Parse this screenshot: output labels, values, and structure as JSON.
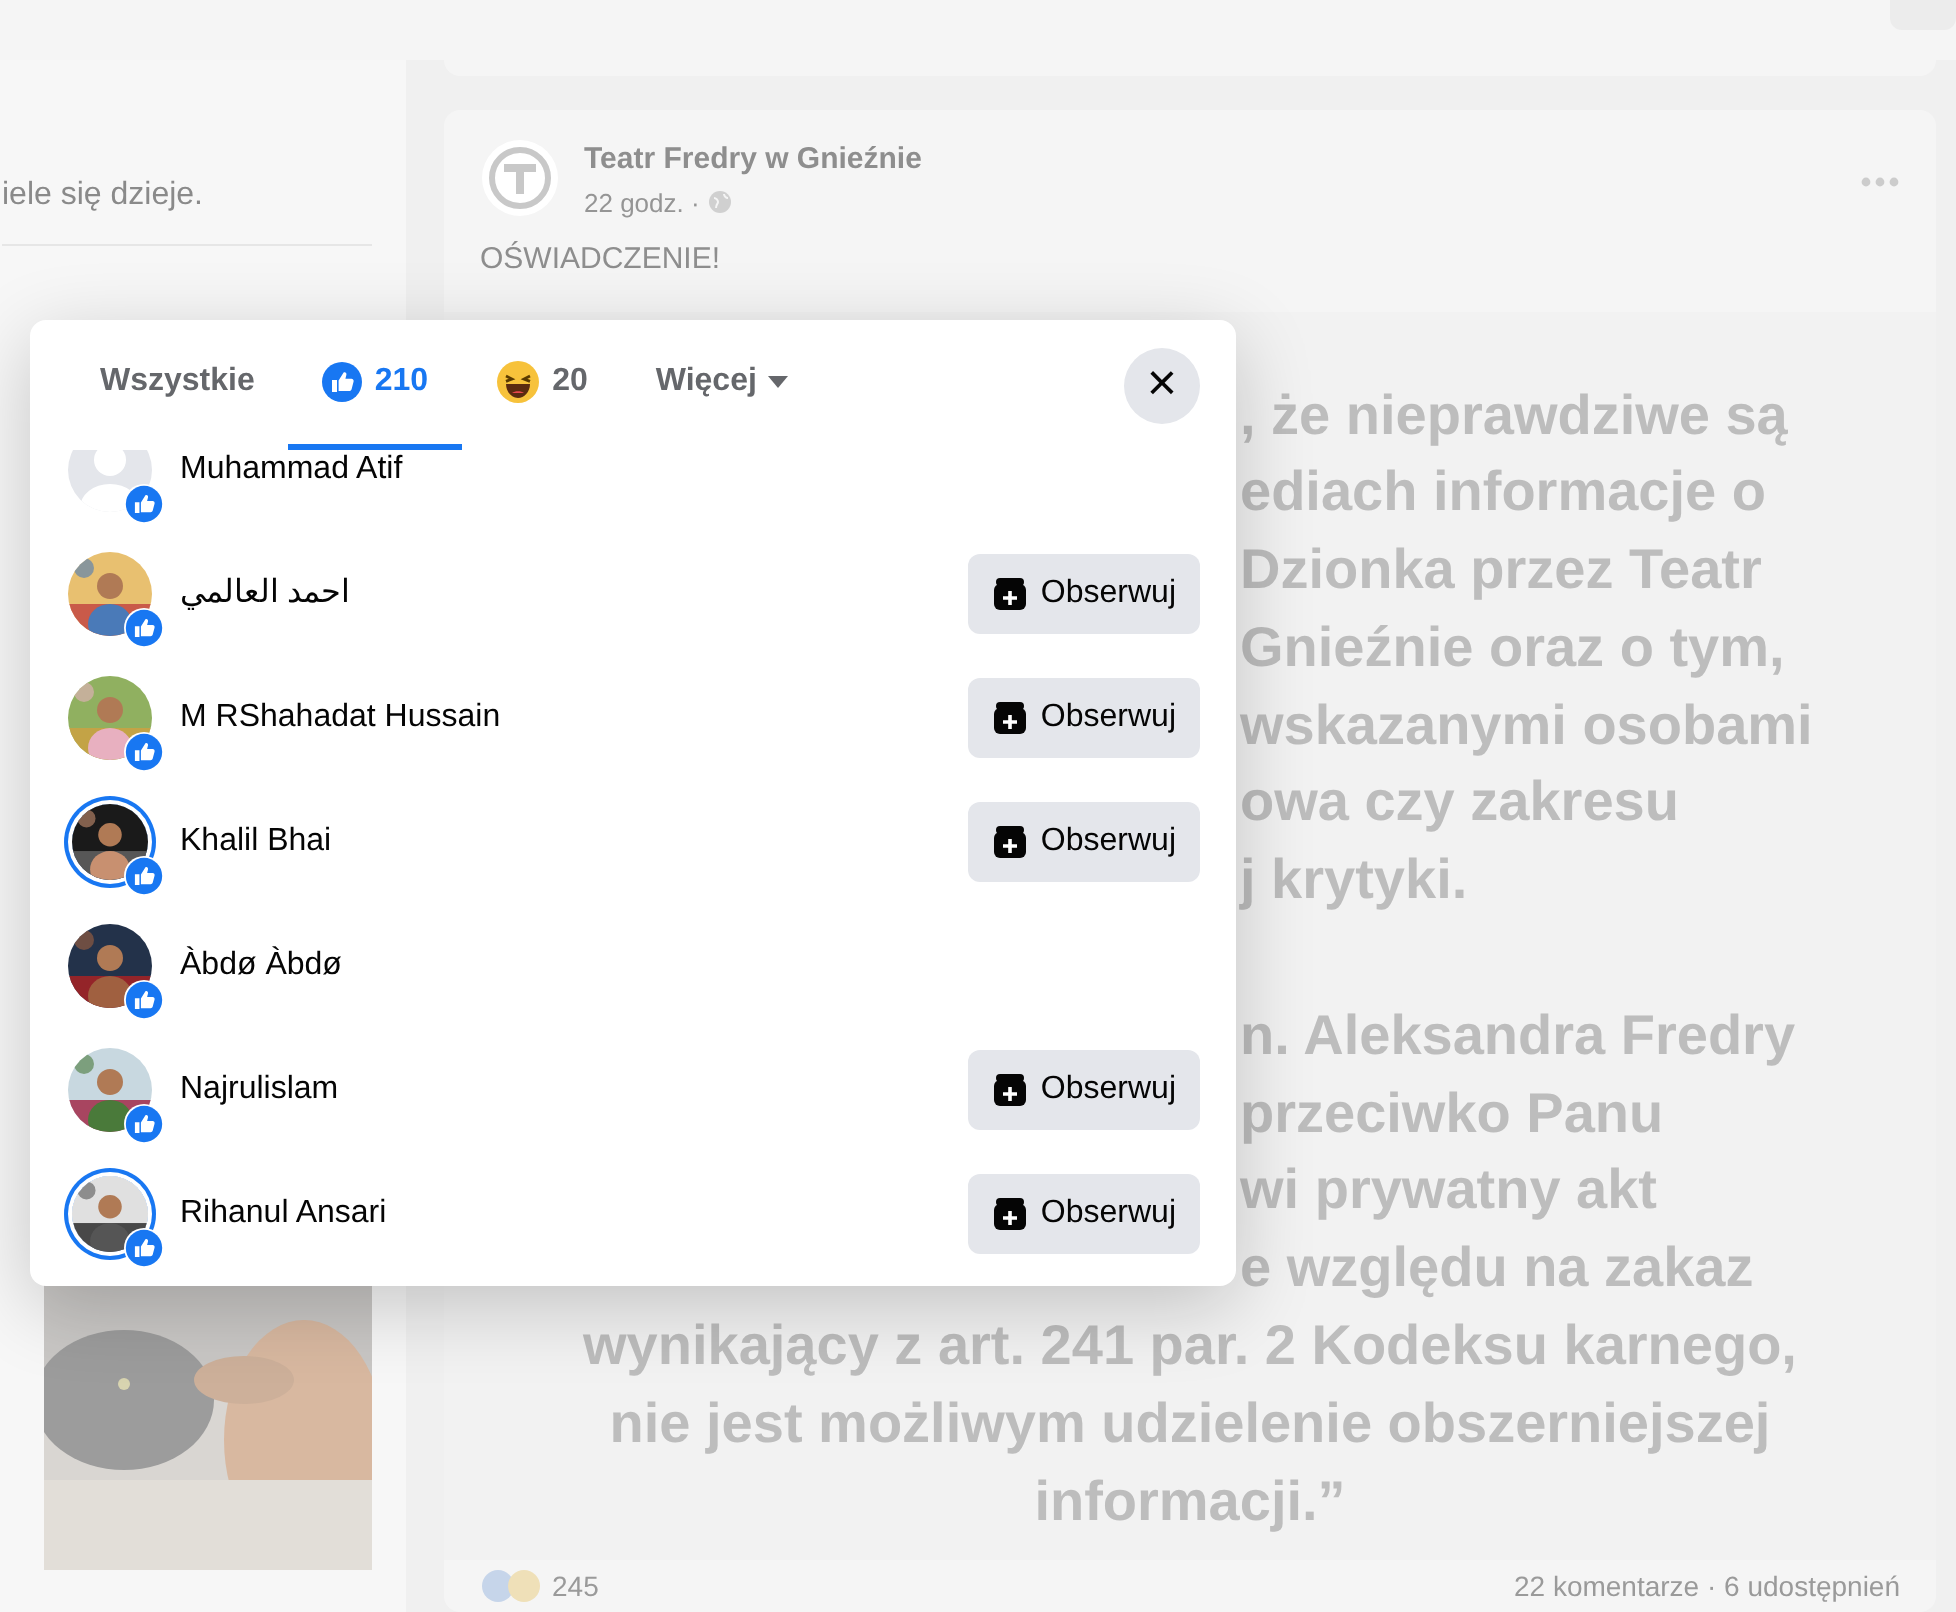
{
  "left_card": {
    "text": "iele się dzieje."
  },
  "post": {
    "author": "Teatr Fredry w Gnieźnie",
    "time": "22 godz. ·",
    "text": "OŚWIADCZENIE!",
    "image_lines": [
      {
        "text": ", że nieprawdziwe są",
        "covered": true
      },
      {
        "text": "ediach informacje o",
        "covered": true
      },
      {
        "text": "Dzionka przez Teatr",
        "covered": true
      },
      {
        "text": "Gnieźnie oraz o tym,",
        "covered": true
      },
      {
        "text": "wskazanymi osobami",
        "covered": true
      },
      {
        "text": "owa czy zakresu",
        "covered": true
      },
      {
        "text": "j krytyki.",
        "covered": true
      },
      {
        "text": "n. Aleksandra Fredry",
        "covered": true
      },
      {
        "text": "przeciwko Panu",
        "covered": true
      },
      {
        "text": "wi prywatny akt",
        "covered": true
      },
      {
        "text": "e względu na zakaz",
        "covered": true
      },
      {
        "text": "wynikający z art. 241 par. 2 Kodeksu karnego,",
        "covered": false
      },
      {
        "text": "nie jest możliwym udzielenie obszerniejszej",
        "covered": false
      },
      {
        "text": "informacji.”",
        "covered": false
      }
    ],
    "reaction_count": "245",
    "stats": "22 komentarze · 6 udostępnień"
  },
  "dialog": {
    "tabs": [
      {
        "kind": "all",
        "label": "Wszystkie",
        "selected": false
      },
      {
        "kind": "like",
        "label": "210",
        "selected": true
      },
      {
        "kind": "haha",
        "label": "20",
        "selected": false
      },
      {
        "kind": "more",
        "label": "Więcej",
        "selected": false
      }
    ],
    "close": "×",
    "people": [
      {
        "name": "Muhammad Atif",
        "kind": "default",
        "story_ring": false
      },
      {
        "name": "احمد العالمي",
        "kind": "picture",
        "story_ring": false,
        "follow": "Obserwuj"
      },
      {
        "name": "M RShahadat Hussain",
        "kind": "picture",
        "story_ring": false,
        "follow": "Obserwuj"
      },
      {
        "name": "Khalil Bhai",
        "kind": "picture",
        "story_ring": true,
        "follow": "Obserwuj"
      },
      {
        "name": "Àbdø Àbdø",
        "kind": "picture",
        "story_ring": false
      },
      {
        "name": "Najrulislam",
        "kind": "picture",
        "story_ring": false,
        "follow": "Obserwuj"
      },
      {
        "name": "Rihanul Ansari",
        "kind": "picture",
        "story_ring": true,
        "follow": "Obserwuj"
      }
    ]
  }
}
